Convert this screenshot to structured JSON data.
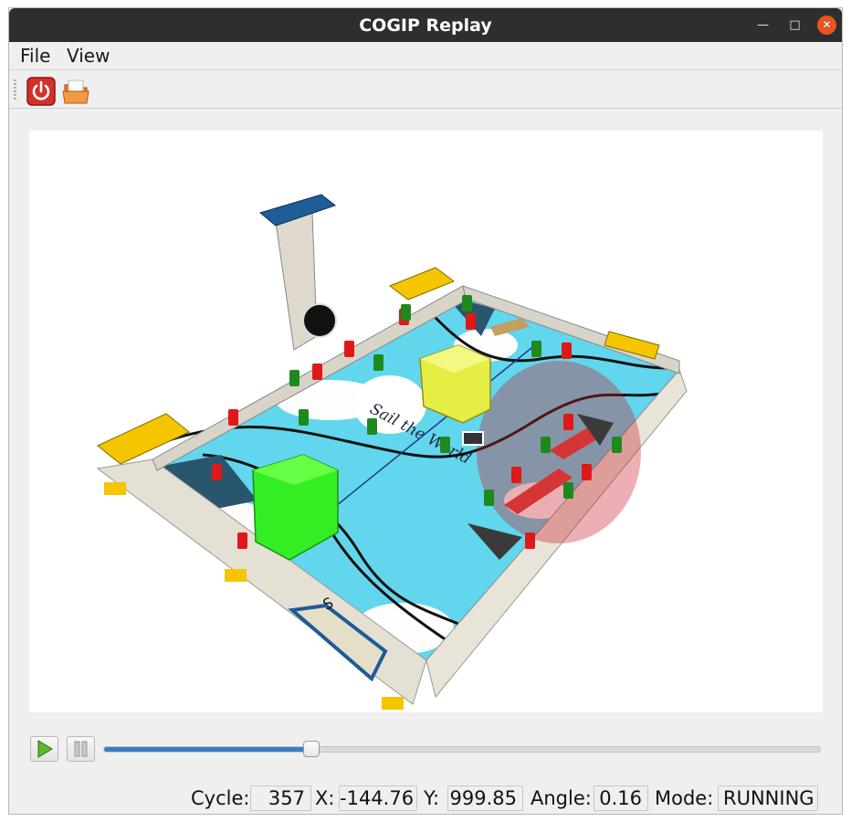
{
  "window": {
    "title": "COGIP Replay"
  },
  "menu": {
    "file": "File",
    "view": "View"
  },
  "toolbar": {
    "power_icon": "power-icon",
    "open_icon": "open-folder-icon"
  },
  "playback": {
    "play_icon": "play-icon",
    "pause_icon": "pause-icon",
    "progress": 0.29
  },
  "board": {
    "sail_text": "Sail the World",
    "marker_text": "S"
  },
  "status": {
    "cycle_label": "Cycle:",
    "cycle_value": "357",
    "x_label": "X:",
    "x_value": "-144.76",
    "y_label": "Y:",
    "y_value": "999.85",
    "angle_label": "Angle:",
    "angle_value": "0.16",
    "mode_label": "Mode:",
    "mode_value": "RUNNING"
  },
  "colors": {
    "accent": "#e95420",
    "slider": "#3a7dc4",
    "sea": "#5fd8ee",
    "robot_green": "#33ee22",
    "robot_yellow": "#e4ee44"
  }
}
